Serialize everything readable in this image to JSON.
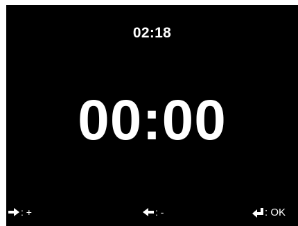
{
  "screen": {
    "clock": "02:18",
    "timer": "00:00"
  },
  "hints": [
    {
      "icon": "arrow-right-icon",
      "label": ": +"
    },
    {
      "icon": "arrow-left-icon",
      "label": ": -"
    },
    {
      "icon": "enter-icon",
      "label": ": OK"
    }
  ],
  "colors": {
    "background": "#000000",
    "text": "#ffffff"
  }
}
